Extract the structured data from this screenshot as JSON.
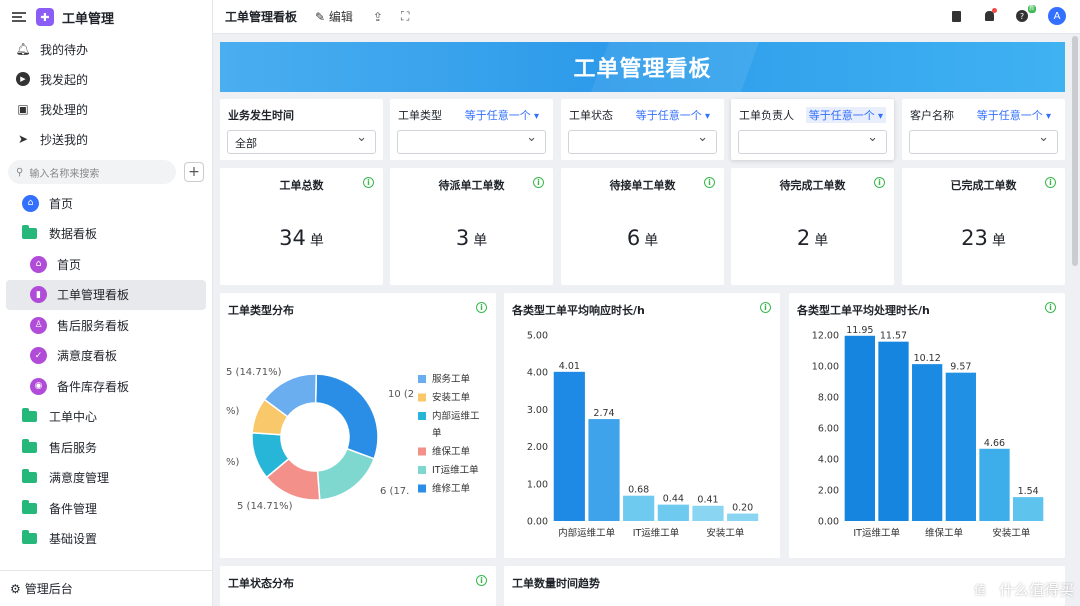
{
  "app": {
    "title": "工单管理",
    "logo_icon": "puzzle-icon"
  },
  "sidebar": {
    "top_items": [
      {
        "label": "我的待办",
        "icon": "bell-icon"
      },
      {
        "label": "我发起的",
        "icon": "send-circle-icon"
      },
      {
        "label": "我处理的",
        "icon": "inbox-icon"
      },
      {
        "label": "抄送我的",
        "icon": "paper-plane-icon"
      }
    ],
    "search_placeholder": "输入名称来搜索",
    "tree": [
      {
        "label": "首页",
        "icon": "home-icon",
        "level": 0,
        "color": "#3370ff"
      },
      {
        "label": "数据看板",
        "icon": "folder-icon",
        "level": 0
      },
      {
        "label": "首页",
        "icon": "home-icon",
        "level": 1,
        "color": "#b04cd8"
      },
      {
        "label": "工单管理看板",
        "icon": "bar-chart-icon",
        "level": 1,
        "color": "#b04cd8",
        "active": true
      },
      {
        "label": "售后服务看板",
        "icon": "user-icon",
        "level": 1,
        "color": "#b04cd8"
      },
      {
        "label": "满意度看板",
        "icon": "shield-check-icon",
        "level": 1,
        "color": "#b04cd8"
      },
      {
        "label": "备件库存看板",
        "icon": "disc-icon",
        "level": 1,
        "color": "#b04cd8"
      },
      {
        "label": "工单中心",
        "icon": "folder-icon",
        "level": 0
      },
      {
        "label": "售后服务",
        "icon": "folder-icon",
        "level": 0
      },
      {
        "label": "满意度管理",
        "icon": "folder-icon",
        "level": 0
      },
      {
        "label": "备件管理",
        "icon": "folder-icon",
        "level": 0
      },
      {
        "label": "基础设置",
        "icon": "folder-icon",
        "level": 0
      }
    ],
    "footer": "管理后台"
  },
  "topbar": {
    "title": "工单管理看板",
    "edit": "编辑",
    "badge_new": "新"
  },
  "banner": {
    "title": "工单管理看板"
  },
  "filters": [
    {
      "label": "业务发生时间",
      "value": "全部",
      "bold": true
    },
    {
      "label": "工单类型",
      "op": "等于任意一个",
      "value": ""
    },
    {
      "label": "工单状态",
      "op": "等于任意一个",
      "value": ""
    },
    {
      "label": "工单负责人",
      "op": "等于任意一个",
      "value": ""
    },
    {
      "label": "客户名称",
      "op": "等于任意一个",
      "value": ""
    }
  ],
  "stats": [
    {
      "title": "工单总数",
      "value": "34",
      "unit": "单"
    },
    {
      "title": "待派单工单数",
      "value": "3",
      "unit": "单"
    },
    {
      "title": "待接单工单数",
      "value": "6",
      "unit": "单"
    },
    {
      "title": "待完成工单数",
      "value": "2",
      "unit": "单"
    },
    {
      "title": "已完成工单数",
      "value": "23",
      "unit": "单"
    }
  ],
  "chart_titles": {
    "pie": "工单类型分布",
    "response": "各类型工单平均响应时长/h",
    "process": "各类型工单平均处理时长/h",
    "status": "工单状态分布",
    "trend": "工单数量时间趋势"
  },
  "chart_data": [
    {
      "type": "pie",
      "title": "工单类型分布",
      "categories": [
        "服务工单",
        "安装工单",
        "内部运维工单",
        "维保工单",
        "IT运维工单",
        "维修工单"
      ],
      "values": [
        5,
        3,
        4,
        5,
        6,
        10
      ],
      "colors": [
        "#6aaef0",
        "#f8c86a",
        "#28b6d8",
        "#f4908a",
        "#7ed8d0",
        "#2b8ee6"
      ],
      "visible_labels": [
        "10 (2",
        "6 (17.",
        "5 (14.71%)",
        "%)",
        "%)",
        "5 (14.71%)"
      ],
      "legend": "right"
    },
    {
      "type": "bar",
      "title": "各类型工单平均响应时长/h",
      "categories": [
        "内部运维工单",
        "",
        "IT运维工单",
        "",
        "安装工单",
        ""
      ],
      "values": [
        4.01,
        2.74,
        0.68,
        0.44,
        0.41,
        0.2
      ],
      "labels": [
        "4.01",
        "2.74",
        "0.68",
        "0.44",
        "0.41",
        "0.20"
      ],
      "colors": [
        "#1f8ae6",
        "#3ea3ea",
        "#6fcaf0",
        "#6fcaf0",
        "#8ad6f2",
        "#8ad6f2"
      ],
      "ylim": [
        0,
        5
      ],
      "yticks": [
        "0.00",
        "1.00",
        "2.00",
        "3.00",
        "4.00",
        "5.00"
      ]
    },
    {
      "type": "bar",
      "title": "各类型工单平均处理时长/h",
      "categories": [
        "IT运维工单",
        "",
        "维保工单",
        "",
        "安装工单",
        ""
      ],
      "values": [
        11.95,
        11.57,
        10.12,
        9.57,
        4.66,
        1.54
      ],
      "labels": [
        "11.95",
        "11.57",
        "10.12",
        "9.57",
        "4.66",
        "1.54"
      ],
      "colors": [
        "#1585e0",
        "#1585e0",
        "#1a8ae2",
        "#1f90e4",
        "#3eaeea",
        "#5ec4ee"
      ],
      "ylim": [
        0,
        12
      ],
      "yticks": [
        "0.00",
        "2.00",
        "4.00",
        "6.00",
        "8.00",
        "10.00",
        "12.00"
      ]
    }
  ],
  "watermark": "什么值得买"
}
